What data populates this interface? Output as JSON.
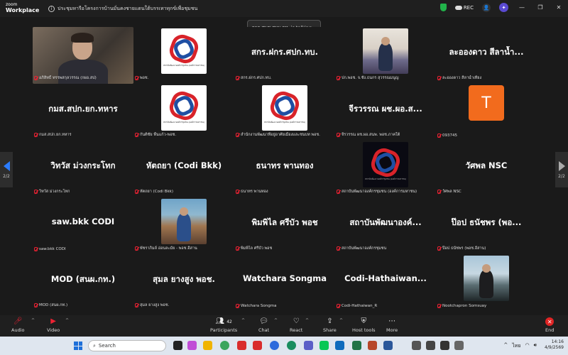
{
  "app": {
    "brand_top": "zoom",
    "brand_bottom": "Workplace",
    "meeting_title": "ประชุมหารือโครงการบ้านมั่นคงชายแดนใต้บรรเทาทุกข์เพื่อชุมชน",
    "rec_label": "REC"
  },
  "talking_banner": "กผอ.สพช.สผม.กท. is talking...",
  "nav": {
    "left_page": "2/2",
    "right_page": "2/2"
  },
  "tiles": [
    {
      "big": "",
      "label": "อภิสิทธิ์ ทรรพสกุลวรรณ (กผอ.สป)"
    },
    {
      "big": "",
      "label": "พอช."
    },
    {
      "big": "สกร.ฝกร.ศปก.ทบ.",
      "label": "สกร.ฝกร.ศปก.ทบ."
    },
    {
      "big": "",
      "label": "ปก.พอช. จ.ชัง.ธนกร สุวรรณมนูญ"
    },
    {
      "big": "ละอองดาว สีลาน้ำ...",
      "label": "ละอองดาว สีลาน้ำเที่ยง"
    },
    {
      "big": "กมส.สปก.ยก.ทหาร",
      "label": "กมส.สปก.ยก.ทหาร"
    },
    {
      "big": "",
      "label": "กันติชัย พื้นแก้ว-พอช."
    },
    {
      "big": "",
      "label": "สำนักงานพัฒนาที่อยู่อาศัยเมืองและชนบท พอช."
    },
    {
      "big": "จีรวรรณ ผช.ผอ.ส...",
      "label": "จีรวรรณ ผช.ผอ.สนพ. พอช.ภาคใต้"
    },
    {
      "big": "",
      "avatar_letter": "T",
      "label": "093745"
    },
    {
      "big": "วิทวัส ม่วงกระโทก",
      "label": "วิทวัส ม่วงกระโทก"
    },
    {
      "big": "หัตถยา (Codi Bkk)",
      "label": "หัตถยา (Codi Bkk)"
    },
    {
      "big": "ธนาทร พานทอง",
      "label": "ธนาทร พานทอง"
    },
    {
      "big": "",
      "label": "สถาบันพัฒนาองค์กรชุมชน (องค์การมหาชน)"
    },
    {
      "big": "วัศพล NSC",
      "label": "วัศพล NSC"
    },
    {
      "big": "saw.bkk CODI",
      "label": "saw.bkk CODI"
    },
    {
      "big": "",
      "label": "พัชราภิมล์ อ่อนละมัย - พอช.อีสาน"
    },
    {
      "big": "พิมพิไล ศรีบัว พอช",
      "label": "พิมพิไล ศรีบัว พอช"
    },
    {
      "big": "สถาบันพัฒนาองค์...",
      "label": "สถาบันพัฒนาองค์กรชุมชน"
    },
    {
      "big": "ป๊อป ธนัชพร (พอ...",
      "label": "ป๊อป ธนัชพร (พอช.อีสาน)"
    },
    {
      "big": "MOD (สนผ.กท.)",
      "label": "MOD (สนผ.กท.)"
    },
    {
      "big": "สุมล ยางสูง  พอช.",
      "label": "สุมล ยางสูง  พอช."
    },
    {
      "big": "Watchara Songma",
      "label": "Watchara Songma"
    },
    {
      "big": "Codi-Hathaiwan...",
      "label": "Codi-Hathaiwan_R"
    },
    {
      "big": "",
      "label": "Nootchapron Somsuay"
    }
  ],
  "logo_text": "สถาบันพัฒนาองค์กรชุมชน (องค์การมหาชน)",
  "toolbar": {
    "audio": "Audio",
    "video": "Video",
    "participants": "Participants",
    "participants_count": "42",
    "chat": "Chat",
    "react": "React",
    "share": "Share",
    "host_tools": "Host tools",
    "more": "More",
    "end": "End"
  },
  "taskbar": {
    "search": "Search",
    "lang": "ไทย",
    "time": "14:16",
    "date": "4/9/2569"
  },
  "colors": {
    "accent": "#2b7cff",
    "end": "#e02424",
    "avatar_t": "#f26b1d"
  }
}
